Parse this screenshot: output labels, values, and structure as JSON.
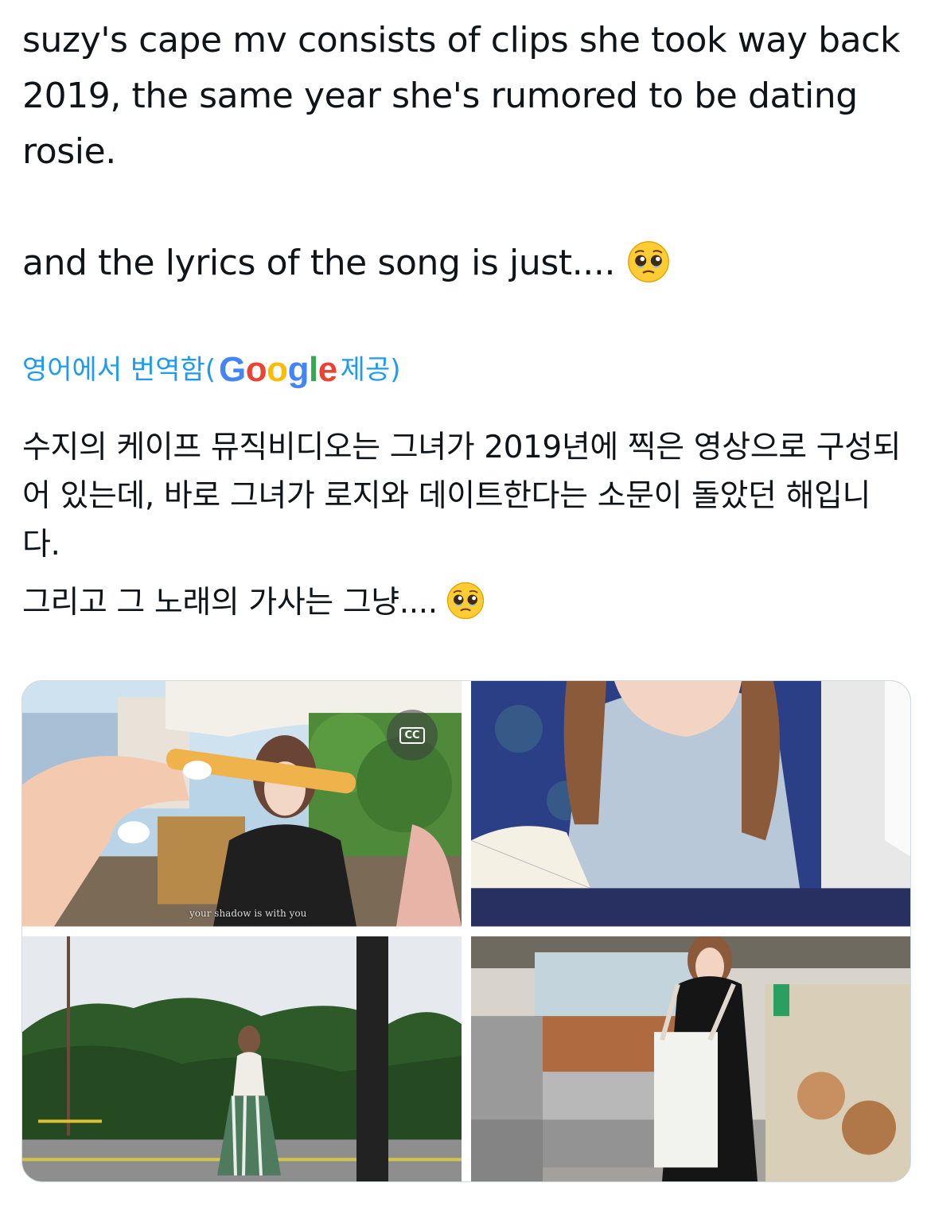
{
  "tweet": {
    "paragraph1": "suzy's cape mv consists of clips she took way back 2019, the same year she's rumored to be dating rosie.",
    "paragraph2": "and the lyrics of the song is just....",
    "emoji": "pleading-face-with-tears"
  },
  "translation": {
    "prefix": "영어에서 번역함(",
    "google": "Google",
    "suffix": " 제공)",
    "paragraph1": "수지의 케이프 뮤직비디오는 그녀가 2019년에 찍은 영상으로 구성되어 있는데, 바로 그녀가 로지와 데이트한다는 소문이 돌았던 해입니다.",
    "paragraph2": "그리고 그 노래의 가사는 그냥....",
    "link_color": "#1d9bf0"
  },
  "media": {
    "cc_label": "CC",
    "subtitle": "your shadow is with you",
    "items": [
      {
        "name": "video-clip-cafe"
      },
      {
        "name": "photo-train-seat"
      },
      {
        "name": "photo-riverside"
      },
      {
        "name": "photo-market"
      }
    ]
  }
}
